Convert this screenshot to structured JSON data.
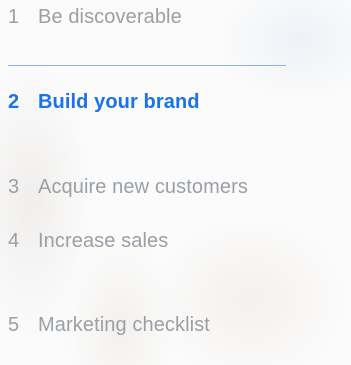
{
  "steps": [
    {
      "number": "1",
      "label": "Be discoverable",
      "active": false
    },
    {
      "number": "2",
      "label": "Build your brand",
      "active": true
    },
    {
      "number": "3",
      "label": "Acquire new customers",
      "active": false
    },
    {
      "number": "4",
      "label": "Increase sales",
      "active": false
    },
    {
      "number": "5",
      "label": "Marketing checklist",
      "active": false
    }
  ],
  "colors": {
    "active": "#1a73e8",
    "inactive": "#9aa0a6",
    "divider": "#8ab4f8"
  }
}
